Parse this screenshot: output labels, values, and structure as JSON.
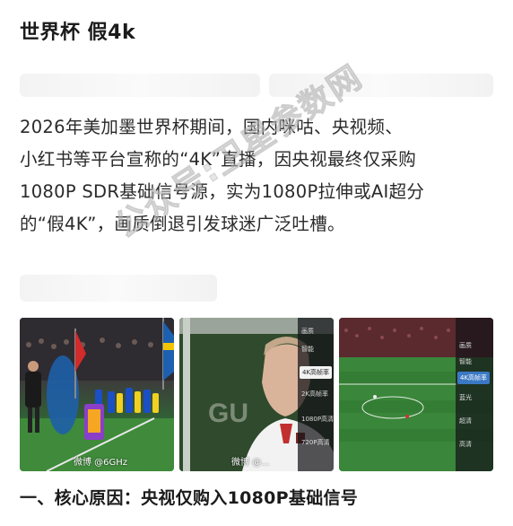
{
  "article": {
    "title": "世界杯 假4k",
    "lines": [
      "2026年美加墨世界杯期间，国内咪咕、央视频、",
      "小红书等平台宣称的“4K”直播，因央视最终仅采购",
      "1080P SDR基础信号源，实为1080P拉伸或AI超分",
      "的“假4K”，画质倒退引发球迷广泛吐槽。"
    ],
    "watermark": "公众号:卫星参数网",
    "images": [
      {
        "credit": "微博 @6GHz"
      },
      {
        "credit": "微博 @...",
        "overlay": "GU",
        "menu": [
          "画质",
          "智能",
          "4K高帧率",
          "2K高帧率",
          "1080P高清",
          "720P高清"
        ]
      },
      {
        "menu": [
          "画质",
          "智能",
          "4K高帧率",
          "蓝光",
          "超清",
          "高清"
        ]
      }
    ],
    "section_heading": "一、核心原因：央视仅购入1080P基础信号"
  },
  "colors": {
    "text": "#2a2a2a",
    "heading": "#1b1b1b",
    "watermark": "#bebebe",
    "pitch_green": "#3b8a3c"
  }
}
